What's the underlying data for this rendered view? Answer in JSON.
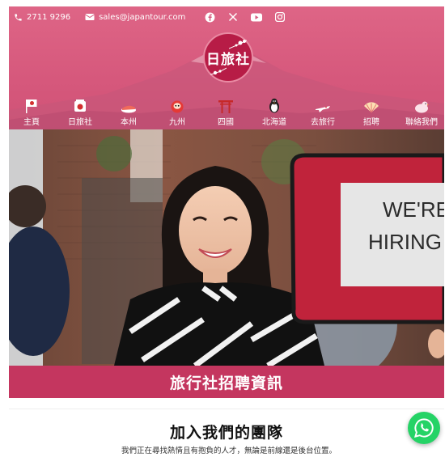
{
  "topbar": {
    "phone": "2711 9296",
    "email": "sales@japantour.com",
    "social": [
      "facebook-icon",
      "x-icon",
      "youtube-icon",
      "instagram-icon"
    ]
  },
  "logo": {
    "text": "日旅社"
  },
  "nav": {
    "items": [
      {
        "label": "主頁",
        "icon": "flag-icon"
      },
      {
        "label": "日旅社",
        "icon": "japan-flag-icon"
      },
      {
        "label": "本州",
        "icon": "sushi-icon"
      },
      {
        "label": "九州",
        "icon": "daruma-icon"
      },
      {
        "label": "四國",
        "icon": "torii-icon"
      },
      {
        "label": "北海道",
        "icon": "penguin-icon"
      },
      {
        "label": "去旅行",
        "icon": "plane-icon"
      },
      {
        "label": "招聘",
        "icon": "fan-icon"
      },
      {
        "label": "聯絡我們",
        "icon": "bird-icon"
      }
    ]
  },
  "hero": {
    "sign_text_1": "WE'RE",
    "sign_text_2": "HIRING"
  },
  "banner": {
    "title": "旅行社招聘資訊"
  },
  "join": {
    "title": "加入我們的團隊",
    "subtitle": "我們正在尋找熱情且有抱負的人才，無論是前線還是後台位置。"
  },
  "colors": {
    "brand": "#d6587c",
    "banner": "#c4365f",
    "logo": "#b71c46",
    "whatsapp": "#25d366"
  }
}
